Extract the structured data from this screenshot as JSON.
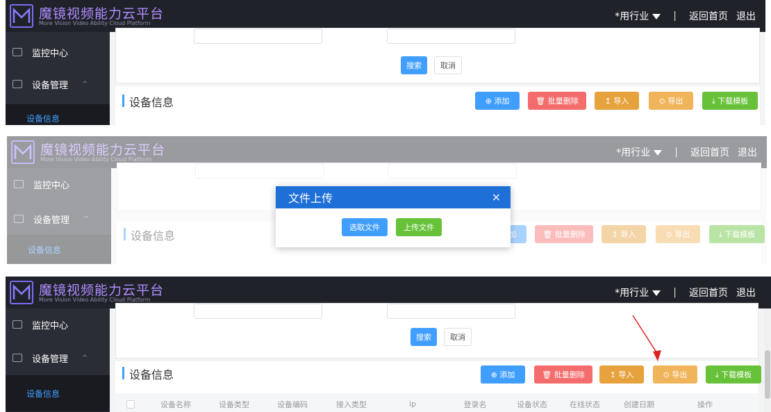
{
  "brand": {
    "title": "魔镜视频能力云平台",
    "subtitle": "More Vision Video Ability Cloud Platform"
  },
  "topbar": {
    "industry_select": "*用行业",
    "separator": "|",
    "home_link": "返回首页",
    "logout_link": "退出"
  },
  "sidebar": {
    "monitor": "监控中心",
    "device_mgmt": "设备管理",
    "device_info": "设备信息",
    "expand_chevron": "^"
  },
  "filter": {
    "search_button": "搜索",
    "cancel_button": "取消"
  },
  "section": {
    "title": "设备信息"
  },
  "toolbar": {
    "add": "⊕ 添加",
    "batch_delete": "🗑 批量删除",
    "import": "↥ 导入",
    "export": "⊙ 导出",
    "download_template": "⤓ 下载模板"
  },
  "table": {
    "columns": [
      "设备名称",
      "设备类型",
      "设备编码",
      "接入类型",
      "ip",
      "登录名",
      "设备状态",
      "在线状态",
      "创建日期",
      "操作"
    ]
  },
  "dialog": {
    "title": "文件上传",
    "close": "×",
    "choose_file": "选取文件",
    "upload_file": "上传文件"
  },
  "colors": {
    "topbar_bg": "#20222a",
    "brand_purple": "#b08cff",
    "primary_blue": "#409eff",
    "danger_red": "#f56c6c",
    "warning_orange": "#e6a23c",
    "success_green": "#67c23a",
    "dialog_header": "#1f6fd8",
    "annotation_arrow": "#e02020"
  },
  "icons": [
    "logo-m-icon",
    "monitor-icon",
    "device-icon",
    "chevron-up-icon",
    "dropdown-triangle-icon",
    "close-icon",
    "red-arrow-annotation"
  ]
}
